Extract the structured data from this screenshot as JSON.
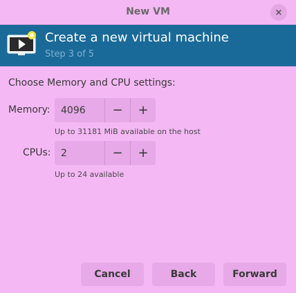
{
  "window": {
    "title": "New VM",
    "close_glyph": "×"
  },
  "header": {
    "title": "Create a new virtual machine",
    "step": "Step 3 of 5",
    "icon": "monitor-play-icon",
    "bg_color": "#1a6a99"
  },
  "form": {
    "section_label": "Choose Memory and CPU settings:",
    "memory": {
      "label": "Memory:",
      "value": "4096",
      "hint": "Up to 31181 MiB available on the host",
      "decrement": "−",
      "increment": "+"
    },
    "cpus": {
      "label": "CPUs:",
      "value": "2",
      "hint": "Up to 24 available",
      "decrement": "−",
      "increment": "+"
    }
  },
  "buttons": {
    "cancel": "Cancel",
    "back": "Back",
    "forward": "Forward"
  },
  "colors": {
    "background": "#f4b8f4",
    "control": "#e7a9e7"
  }
}
